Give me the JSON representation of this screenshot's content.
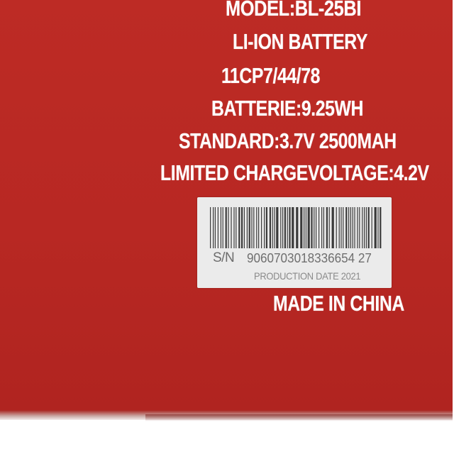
{
  "colors": {
    "battery_red": "#b82823",
    "label_text": "#ffffff",
    "sticker_bg": "#ebebeb",
    "sticker_text": "#6f6f6f"
  },
  "label": {
    "model": "MODEL:BL-25BI",
    "type": "LI-ION BATTERY",
    "cell_code": "11CP7/44/78",
    "energy": "BATTERIE:9.25WH",
    "standard": "STANDARD:3.7V 2500MAH",
    "limited_charge_voltage": "LIMITED CHARGEVOLTAGE:4.2V",
    "origin": "MADE IN CHINA"
  },
  "sticker": {
    "barcode": "barcode",
    "sn_label": "S/N",
    "serial_number": "9060703018336654 27",
    "production_date": "PRODUCTION DATE 2021"
  }
}
